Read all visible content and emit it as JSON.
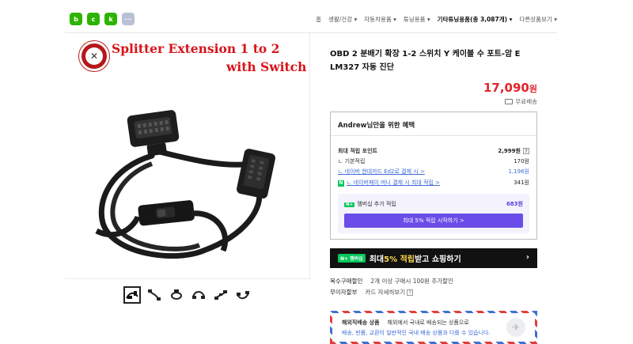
{
  "share": {
    "icons": [
      {
        "name": "blog-icon",
        "glyph": "b",
        "color": "#2db400"
      },
      {
        "name": "cafe-icon",
        "glyph": "c",
        "color": "#2db400"
      },
      {
        "name": "bookmark-icon",
        "glyph": "k",
        "color": "#2db400"
      },
      {
        "name": "more-icon",
        "glyph": "···",
        "color": "#b9c0d3"
      }
    ]
  },
  "breadcrumb": {
    "items": [
      "홈",
      "생활/건강 ▾",
      "자동차용품 ▾",
      "튜닝용품 ▾",
      "기타튜닝용품(총 3,087개) ▾",
      "다른상품보기 ▾"
    ]
  },
  "product_image": {
    "promo_line1": "Splitter Extension 1 to 2",
    "promo_line2": "with Switch"
  },
  "thumbnails": {
    "count": 6,
    "selected_index": 0
  },
  "product": {
    "title": "OBD 2 분배기 확장 1-2 스위치 Y 케이블 수 포트-암 E LM327 자동 진단",
    "price": "17,090",
    "price_unit": "원",
    "shipping": "무료배송"
  },
  "benefit": {
    "header": "Andrew님만을 위한 혜택",
    "max_points_label": "최대 적립 포인트",
    "max_points_value": "2,999원",
    "basic_label": "ㄴ 기본적립",
    "basic_value": "170원",
    "card_label": "ㄴ 네이버 현대카드 Ed2로 결제 시 >",
    "card_value": "1,196원",
    "pay_label": "ㄴ 네이버페이 머니 결제 시 최대 적립 >",
    "pay_value": "341원",
    "membership_badge": "N+",
    "membership_label": "멤버십 추가 적립",
    "membership_value": "683원",
    "start_button": "최대 5% 적립 시작하기 >"
  },
  "banner": {
    "badge": "N+ 멤버십",
    "text_prefix": "최대 ",
    "text_highlight": "5% 적립",
    "text_suffix": " 받고 쇼핑하기",
    "arrow": "›"
  },
  "extra_info": {
    "multi_key": "복수구매할인",
    "multi_value": "2개 이상 구매시 100원 추가할인",
    "installment_key": "무이자할부",
    "installment_value": "카드 자세히보기"
  },
  "overseas": {
    "key": "해외직배송 상품",
    "desc": "해외에서 국내로 배송되는 상품으로",
    "note": "배송, 반품, 교환이 일반적인 국내 배송 상품과 다를 수 있습니다."
  },
  "colors": {
    "price_red": "#e1252c",
    "naver_green": "#03c75a",
    "purple": "#6a4de8",
    "link_blue": "#3d6bd7"
  }
}
